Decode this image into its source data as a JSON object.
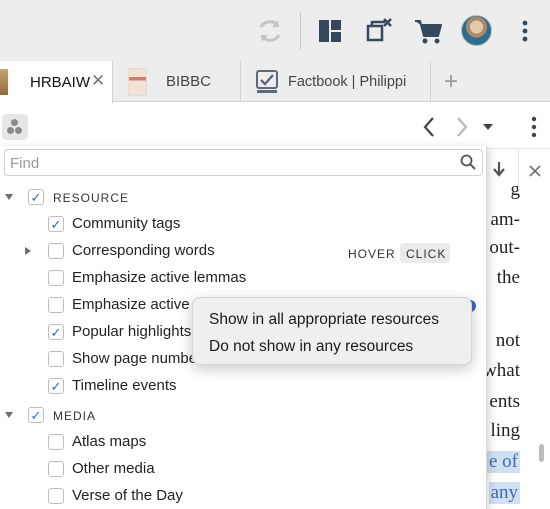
{
  "toolbar": {
    "icons": [
      "sync-icon",
      "layout-icon",
      "close-windows-icon",
      "cart-icon",
      "avatar",
      "more-vert-icon"
    ]
  },
  "tabs": [
    {
      "label": "HRBAIW",
      "icon": "book-cover-icon",
      "active": true,
      "closable": true
    },
    {
      "label": "BIBBC",
      "icon": "book-cover-icon",
      "active": false
    },
    {
      "label": "Factbook | Philippi",
      "icon": "factbook-icon",
      "active": false
    }
  ],
  "panel_header": {
    "icons": [
      "group-icon",
      "back-chevron-icon",
      "forward-chevron-icon",
      "dropdown-caret-icon",
      "more-vert-icon"
    ]
  },
  "find": {
    "placeholder": "Find",
    "value": ""
  },
  "hover_click": {
    "hover": "HOVER",
    "click": "CLICK",
    "selected": "click"
  },
  "categories": [
    {
      "label": "RESOURCE",
      "checked": true,
      "items": [
        {
          "label": "Community tags",
          "checked": true
        },
        {
          "label": "Corresponding words",
          "checked": false,
          "expandable": true
        },
        {
          "label": "Emphasize active lemmas",
          "checked": false
        },
        {
          "label": "Emphasize active r",
          "checked": false
        },
        {
          "label": "Popular highlights",
          "checked": true
        },
        {
          "label": "Show page numbe",
          "checked": false
        },
        {
          "label": "Timeline events",
          "checked": true
        }
      ]
    },
    {
      "label": "MEDIA",
      "checked": true,
      "items": [
        {
          "label": "Atlas maps",
          "checked": false
        },
        {
          "label": "Other media",
          "checked": false
        },
        {
          "label": "Verse of the Day",
          "checked": false
        }
      ]
    }
  ],
  "context_menu": {
    "items": [
      "Show in all appropriate resources",
      "Do not show in any resources"
    ]
  },
  "reader_text": [
    "g",
    "am-",
    "out-",
    "the",
    "not",
    "what",
    "ents",
    "ling",
    "e of",
    "any"
  ],
  "colors": {
    "accent": "#2b66d9",
    "highlight": "#cfe0f3",
    "chrome": "#ededed"
  }
}
